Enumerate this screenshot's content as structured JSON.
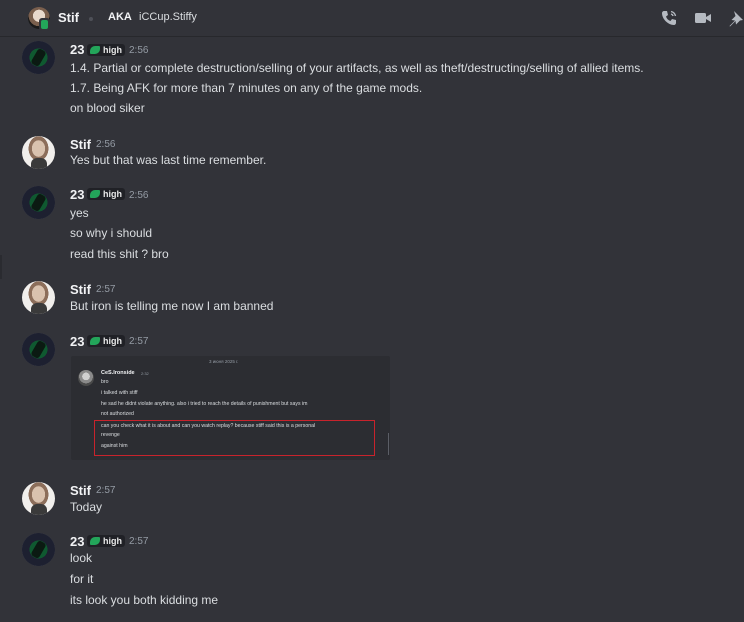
{
  "header": {
    "name": "Stif",
    "aka_label": "AKA",
    "alias": "iCCup.Stiffy",
    "icons": [
      "phone-call-icon",
      "video-call-icon",
      "pin-icon"
    ]
  },
  "colors": {
    "background": "#323339",
    "online": "#23a55a",
    "highlight_box": "#c8232c"
  },
  "messages": [
    {
      "author": "23",
      "badge": "high",
      "time": "2:56",
      "lines": [
        "1.4. Partial or complete destruction/selling of your artifacts, as well as theft/destructing/selling of allied items.",
        "1.7. Being AFK for more than 7 minutes on any of the game mods.",
        "on blood siker"
      ]
    },
    {
      "author": "Stif",
      "time": "2:56",
      "lines": [
        "Yes but that was last time remember."
      ]
    },
    {
      "author": "23",
      "badge": "high",
      "time": "2:56",
      "lines": [
        "yes",
        "so why i should",
        "read this shit ? bro"
      ]
    },
    {
      "author": "Stif",
      "time": "2:57",
      "lines": [
        "But iron is telling me now I am banned"
      ]
    },
    {
      "author": "23",
      "badge": "high",
      "time": "2:57",
      "attachment": {
        "date": "3 июня 2025 г.",
        "author": "CeS.Ironside",
        "time": "2:32",
        "lines": [
          "bro",
          "i talked with stiff",
          "he sad he didnt violate anything. also i tried to reach the details of punishment but says im",
          "not authorized",
          "can you check what it is about and can you watch replay? because stiff said this is a personal",
          "revenge",
          "against him"
        ]
      }
    },
    {
      "author": "Stif",
      "time": "2:57",
      "lines": [
        "Today"
      ]
    },
    {
      "author": "23",
      "badge": "high",
      "time": "2:57",
      "lines": [
        "look",
        "for it",
        "its look you both kidding me"
      ]
    }
  ]
}
